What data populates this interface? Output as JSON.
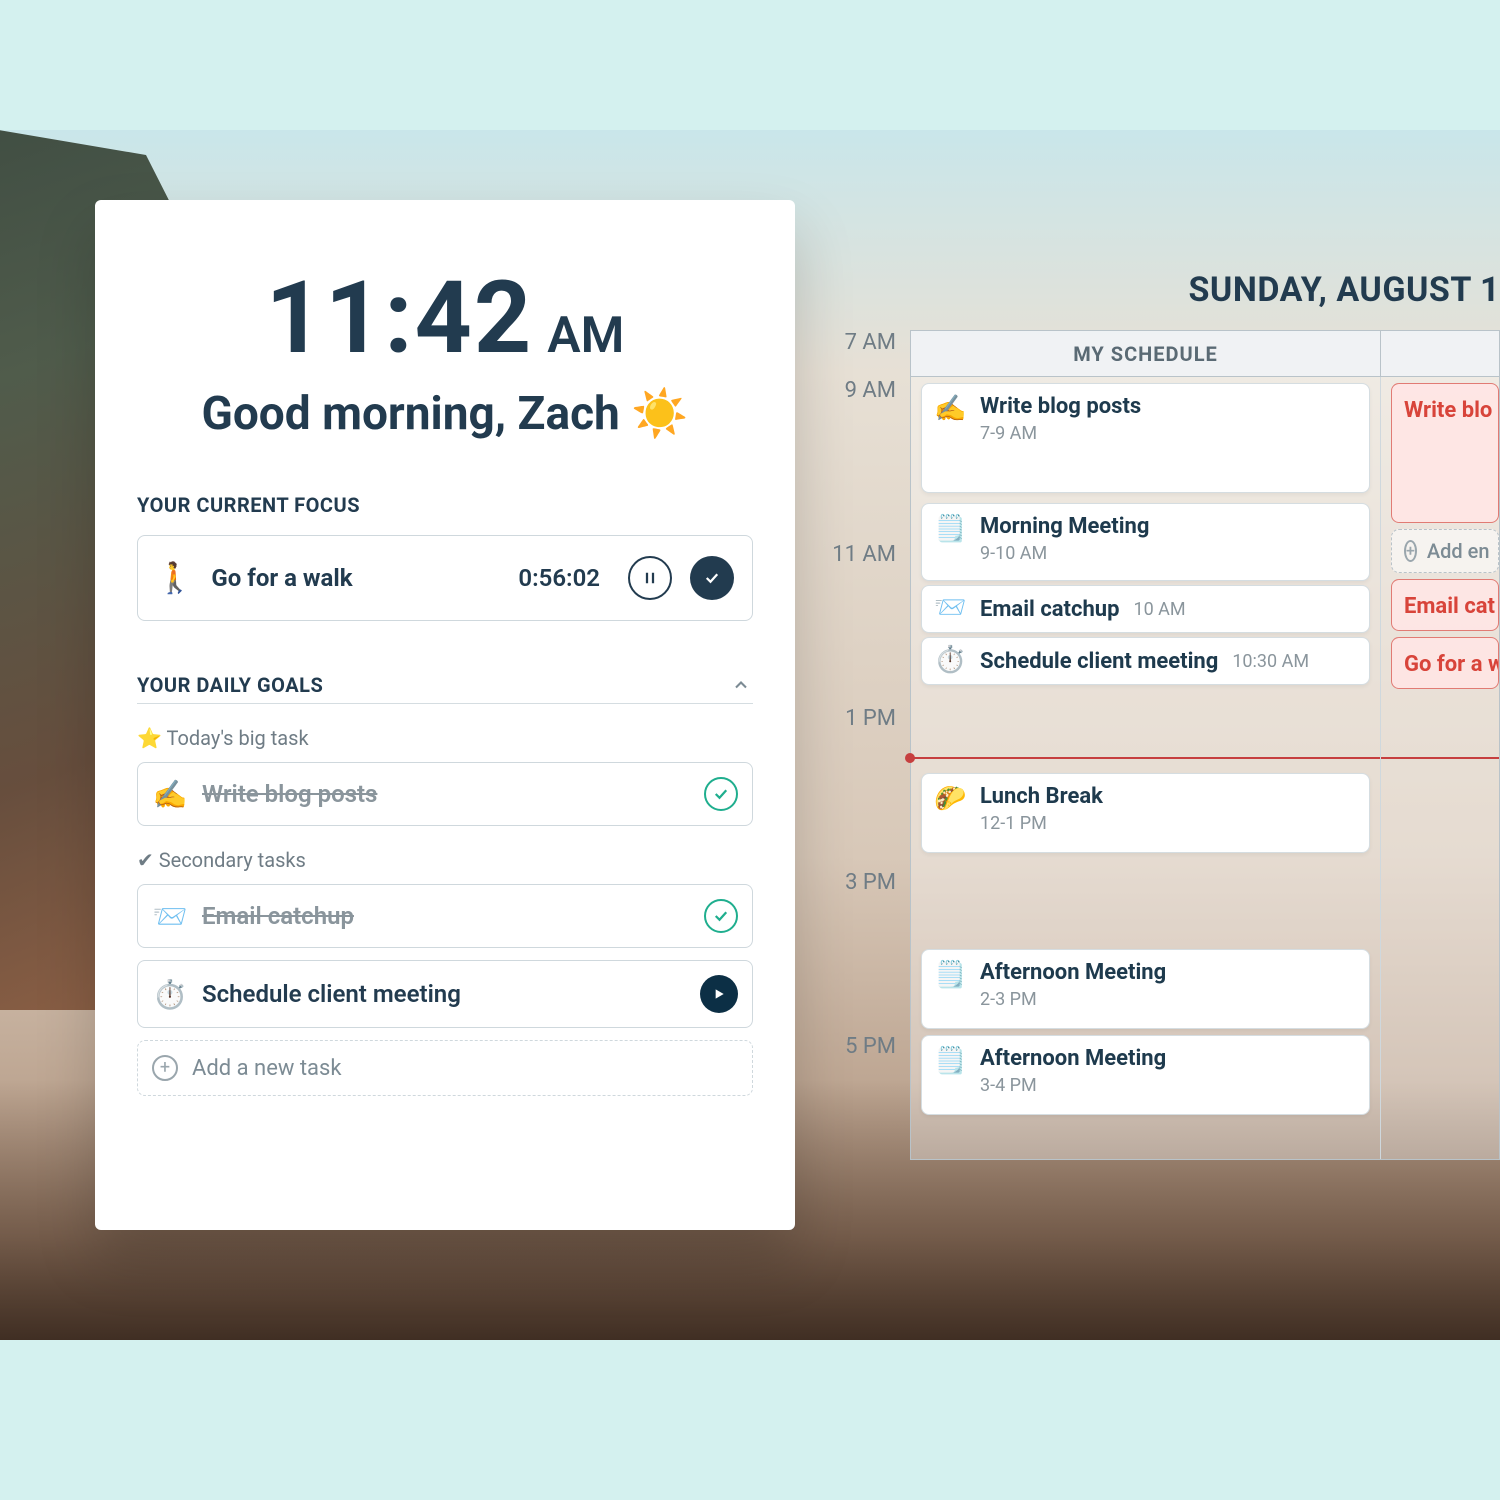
{
  "clock": {
    "time": "11:42",
    "ampm": "AM"
  },
  "greeting": "Good morning, Zach ☀️",
  "focus": {
    "heading": "YOUR CURRENT FOCUS",
    "emoji": "🚶",
    "title": "Go for a walk",
    "timer": "0:56:02"
  },
  "goals": {
    "heading": "YOUR DAILY GOALS",
    "big_label": "⭐ Today's big task",
    "secondary_label": "✔ Secondary tasks",
    "add_label": "Add a new task",
    "big": {
      "emoji": "✍️",
      "label": "Write blog posts",
      "done": true
    },
    "sec1": {
      "emoji": "📨",
      "label": "Email catchup",
      "done": true
    },
    "sec2": {
      "emoji": "⏱️",
      "label": "Schedule client meeting",
      "done": false
    }
  },
  "schedule": {
    "date": "SUNDAY, AUGUST 1",
    "col1": "MY SCHEDULE",
    "hours": [
      "7 AM",
      "9 AM",
      "11 AM",
      "1 PM",
      "3 PM",
      "5 PM"
    ],
    "events": {
      "e1": {
        "emoji": "✍️",
        "title": "Write blog posts",
        "sub": "7-9 AM"
      },
      "e2": {
        "emoji": "🗒️",
        "title": "Morning Meeting",
        "sub": "9-10 AM"
      },
      "e3": {
        "emoji": "📨",
        "title": "Email catchup",
        "sub": "10 AM"
      },
      "e4": {
        "emoji": "⏱️",
        "title": "Schedule client meeting",
        "sub": "10:30 AM"
      },
      "e5": {
        "emoji": "🌮",
        "title": "Lunch Break",
        "sub": "12-1 PM"
      },
      "e6": {
        "emoji": "🗒️",
        "title": "Afternoon Meeting",
        "sub": "2-3 PM"
      },
      "e7": {
        "emoji": "🗒️",
        "title": "Afternoon Meeting",
        "sub": "3-4 PM"
      }
    },
    "alt": {
      "a1": "Write blo",
      "a2": "Add en",
      "a3": "Email cat",
      "a4": "Go for a w"
    }
  }
}
